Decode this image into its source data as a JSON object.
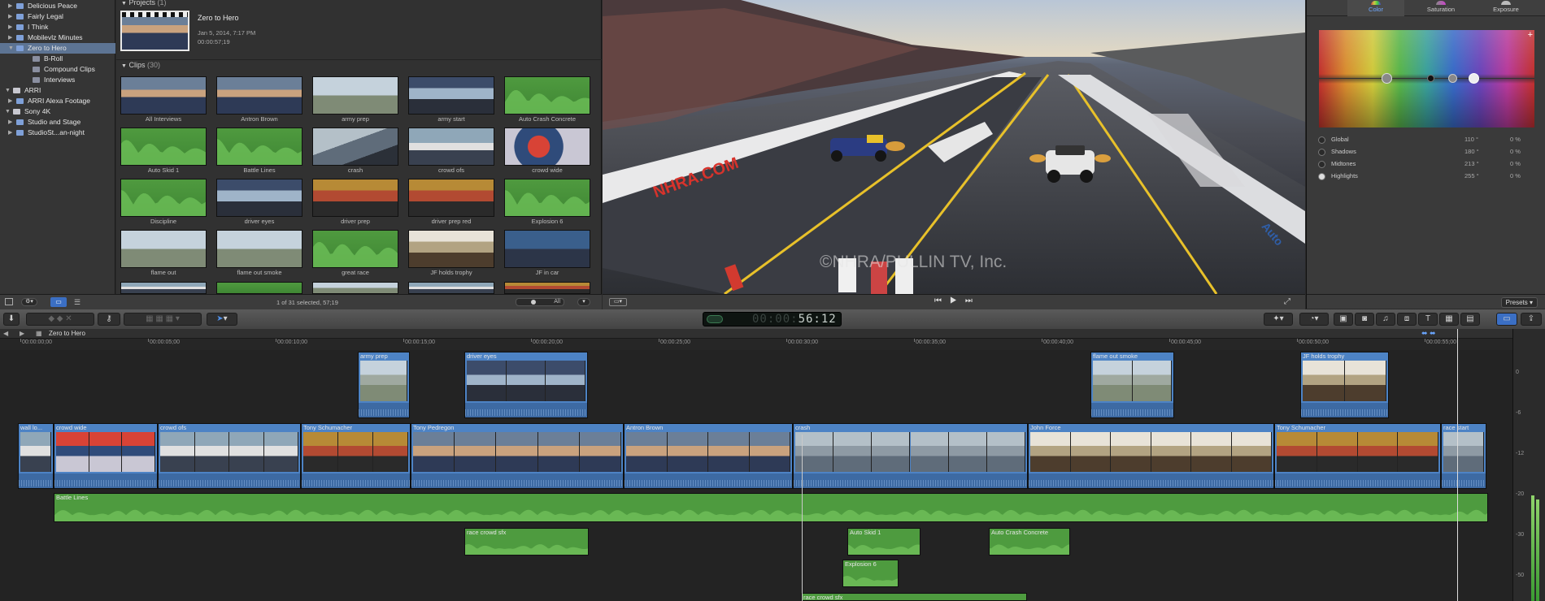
{
  "library": {
    "items": [
      {
        "label": "Delicious Peace",
        "level": 1,
        "selected": false,
        "expanded": false
      },
      {
        "label": "Fairly Legal",
        "level": 1,
        "selected": false,
        "expanded": false
      },
      {
        "label": "I Think",
        "level": 1,
        "selected": false,
        "expanded": false
      },
      {
        "label": "Mobilevlz Minutes",
        "level": 1,
        "selected": false,
        "expanded": false
      },
      {
        "label": "Zero to Hero",
        "level": 1,
        "selected": true,
        "expanded": true
      },
      {
        "label": "B-Roll",
        "level": 2,
        "selected": false,
        "expanded": false
      },
      {
        "label": "Compound Clips",
        "level": 2,
        "selected": false,
        "expanded": false
      },
      {
        "label": "Interviews",
        "level": 2,
        "selected": false,
        "expanded": false
      },
      {
        "label": "ARRI",
        "level": 0,
        "selected": false,
        "expanded": true
      },
      {
        "label": "ARRI Alexa Footage",
        "level": 1,
        "selected": false,
        "expanded": false
      },
      {
        "label": "Sony 4K",
        "level": 0,
        "selected": false,
        "expanded": true
      },
      {
        "label": "Studio and Stage",
        "level": 1,
        "selected": false,
        "expanded": false
      },
      {
        "label": "StudioSt...an-night",
        "level": 1,
        "selected": false,
        "expanded": false
      }
    ]
  },
  "browser": {
    "projects_header": "Projects",
    "projects_count": "(1)",
    "project": {
      "name": "Zero to Hero",
      "date": "Jan 5, 2014, 7:17 PM",
      "duration": "00:00:57;19"
    },
    "clips_header": "Clips",
    "clips_count": "(30)",
    "clips": [
      {
        "label": "All Interviews",
        "kind": "v1"
      },
      {
        "label": "Antron Brown",
        "kind": "v1"
      },
      {
        "label": "army prep",
        "kind": "v7"
      },
      {
        "label": "army start",
        "kind": "v5"
      },
      {
        "label": "Auto Crash Concrete",
        "kind": "audio"
      },
      {
        "label": "Auto Skid 1",
        "kind": "audio"
      },
      {
        "label": "Battle Lines",
        "kind": "audio"
      },
      {
        "label": "crash",
        "kind": "v3"
      },
      {
        "label": "crowd ofs",
        "kind": "v2"
      },
      {
        "label": "crowd wide",
        "kind": "v4"
      },
      {
        "label": "Discipline",
        "kind": "audio"
      },
      {
        "label": "driver eyes",
        "kind": "v5"
      },
      {
        "label": "driver prep",
        "kind": "v6"
      },
      {
        "label": "driver prep red",
        "kind": "v6"
      },
      {
        "label": "Explosion 6",
        "kind": "audio"
      },
      {
        "label": "flame out",
        "kind": "v7"
      },
      {
        "label": "flame out smoke",
        "kind": "v7"
      },
      {
        "label": "great race",
        "kind": "audio"
      },
      {
        "label": "JF holds trophy",
        "kind": "v9"
      },
      {
        "label": "JF in car",
        "kind": "v8"
      }
    ],
    "footer_status": "1 of 31 selected, 57;19",
    "footer_zoom": "All"
  },
  "viewer": {
    "watermark": "©NHRA/PULLIN TV, Inc.",
    "wall_sign": "NHRA.COM",
    "right_sign": "Auto"
  },
  "inspector": {
    "tabs": [
      {
        "label": "Color",
        "active": true
      },
      {
        "label": "Saturation",
        "active": false
      },
      {
        "label": "Exposure",
        "active": false
      }
    ],
    "rows": [
      {
        "label": "Global",
        "angle": "110 °",
        "value": "0 %",
        "selected": false
      },
      {
        "label": "Shadows",
        "angle": "180 °",
        "value": "0 %",
        "selected": false
      },
      {
        "label": "Midtones",
        "angle": "213 °",
        "value": "0 %",
        "selected": false
      },
      {
        "label": "Highlights",
        "angle": "255 °",
        "value": "0 %",
        "selected": true
      }
    ],
    "presets_label": "Presets"
  },
  "toolbar": {
    "timecode": "56:12"
  },
  "timeline": {
    "project_name": "Zero to Hero",
    "ruler": [
      "00:00:00;00",
      "00:00:05;00",
      "00:00:10;00",
      "00:00:15;00",
      "00:00:20;00",
      "00:00:25;00",
      "00:00:30;00",
      "00:00:35;00",
      "00:00:40;00",
      "00:00:45;00",
      "00:00:50;00",
      "00:00:55;00"
    ],
    "meter_labels": [
      "0",
      "-6",
      "-12",
      "-20",
      "-30",
      "-50"
    ],
    "connected_clips": [
      {
        "name": "army prep",
        "variant": "v7"
      },
      {
        "name": "driver eyes",
        "variant": "v5"
      },
      {
        "name": "flame out smoke",
        "variant": "v7"
      },
      {
        "name": "JF holds trophy",
        "variant": "v9"
      }
    ],
    "primary_clips": [
      {
        "name": "wall lo...",
        "variant": "v2"
      },
      {
        "name": "crowd wide",
        "variant": "v4"
      },
      {
        "name": "crowd ofs",
        "variant": "v2"
      },
      {
        "name": "Tony Schumacher",
        "variant": "v6"
      },
      {
        "name": "Tony Pedregon",
        "variant": "v1"
      },
      {
        "name": "Antron Brown",
        "variant": "v1"
      },
      {
        "name": "crash",
        "variant": "v3"
      },
      {
        "name": "John Force",
        "variant": "v9"
      },
      {
        "name": "Tony Schumacher",
        "variant": "v6"
      },
      {
        "name": "race start",
        "variant": "v3"
      }
    ],
    "audio_clips": [
      {
        "name": "Battle Lines"
      },
      {
        "name": "race crowd sfx"
      },
      {
        "name": "Auto Skid 1"
      },
      {
        "name": "Auto Crash Concrete"
      },
      {
        "name": "Explosion 6"
      },
      {
        "name": "race crowd sfx"
      }
    ]
  }
}
